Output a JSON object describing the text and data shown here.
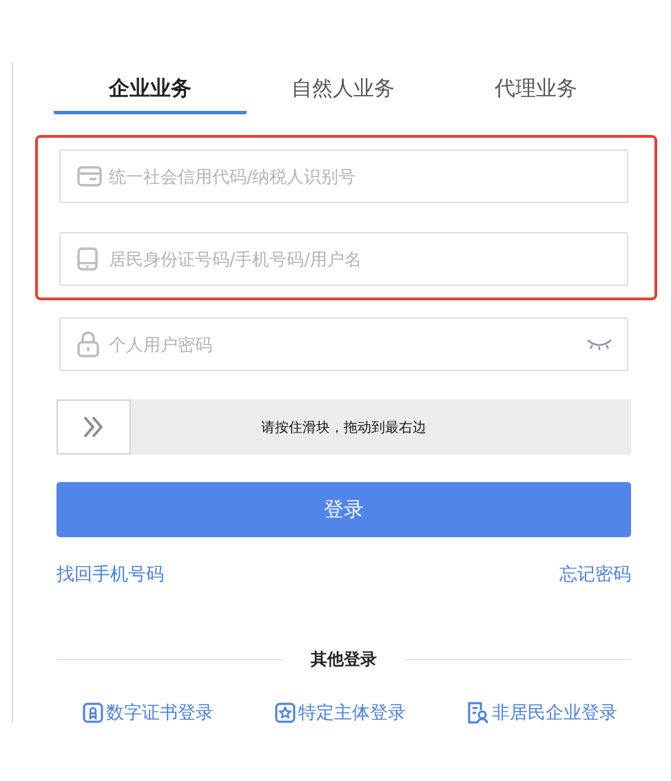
{
  "tabs": [
    {
      "label": "企业业务",
      "selected": true
    },
    {
      "label": "自然人业务",
      "selected": false
    },
    {
      "label": "代理业务",
      "selected": false
    }
  ],
  "fields": [
    {
      "kind": "card",
      "placeholder": "统一社会信用代码/纳税人识别号",
      "highlighted": true
    },
    {
      "kind": "phone",
      "placeholder": "居民身份证号码/手机号码/用户名",
      "highlighted": true
    },
    {
      "kind": "password",
      "placeholder": "个人用户密码",
      "highlighted": false
    }
  ],
  "slider": {
    "hint": "请按住滑块，拖动到最右边",
    "level": 0
  },
  "login_button": "登录",
  "links": [
    {
      "label": "找回手机号码"
    },
    {
      "label": "忘记密码"
    }
  ],
  "other_login": {
    "title": "其他登录",
    "options": [
      {
        "kind": "certificate",
        "label": "数字证书登录"
      },
      {
        "kind": "star",
        "label": "特定主体登录"
      },
      {
        "kind": "document",
        "label": "非居民企业登录"
      }
    ]
  }
}
